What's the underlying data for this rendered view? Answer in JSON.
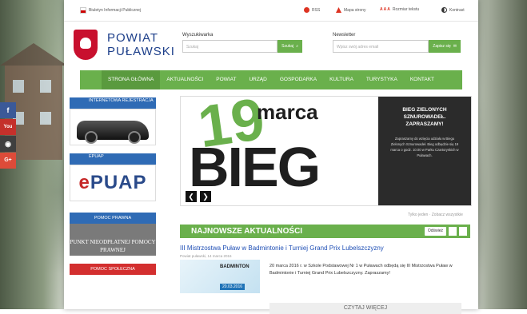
{
  "topbar": {
    "bip": "Biuletyn Informacji Publicznej",
    "rss": "RSS",
    "mapa": "Mapa strony",
    "aaa": "A A A",
    "rozmiar": "Rozmiar tekstu",
    "kontrast": "Kontrast"
  },
  "logo": {
    "line1": "POWIAT",
    "line2": "PUŁAWSKI"
  },
  "search": {
    "label": "Wyszukiwarka",
    "placeholder": "Szukaj",
    "button": "Szukaj"
  },
  "newsletter": {
    "label": "Newsletter",
    "placeholder": "Wpisz swój adres email",
    "button": "Zapisz się"
  },
  "nav": [
    "STRONA GŁÓWNA",
    "AKTUALNOŚCI",
    "POWIAT",
    "URZĄD",
    "GOSPODARKA",
    "KULTURA",
    "TURYSTYKA",
    "KONTAKT"
  ],
  "left_cards": {
    "reg_title": "INTERNETOWA REJESTRACJA",
    "epuap_title": "EPUAP",
    "epuap_logo_e": "e",
    "epuap_logo_rest": "PUAP",
    "pomoc_title": "POMOC PRAWNA",
    "pomoc_body": "PUNKT NIEODPŁATNEJ POMOCY PRAWNEJ",
    "spoleczna_title": "POMOC SPOŁECZNA"
  },
  "slider": {
    "big19": "19",
    "marca": "marca",
    "bieg": "BIEG",
    "heading": "BIEG ZIELONYCH SZNUROWADEŁ. ZAPRASZAMY!",
    "text": "Zapraszamy do wzięcia udziału w Biegu Zielonych Sznurowadeł. Bieg odbędzie się 19 marca o godz. 10.00 w Parku Czartoryskich w Puławach.",
    "prev": "❮",
    "next": "❯",
    "links": "Tylko jeden · Zobacz wszystkie"
  },
  "news": {
    "header": "NAJNOWSZE AKTUALNOŚCI",
    "odswiez": "Odśwież",
    "title": "III Mistrzostwa Puław w Badmintonie i Turniej Grand Prix Lubelszczyzny",
    "date": "Powiat puławski, 14 marca 2016",
    "thumb_title": "BADMINTON",
    "thumb_date": "20.03.2016",
    "text": "20 marca 2016 r. w Szkole Podstawowej Nr 1 w Puławach odbędą się III Mistrzostwa Puław w Badmintonie i Turniej Grand Prix Lubelszczyzny. Zapraszamy!",
    "more": "CZYTAJ WIĘCEJ"
  },
  "social": {
    "fb": "f",
    "yt": "You",
    "ig": "◉",
    "gp": "G+"
  },
  "colors": {
    "green": "#6ab04c",
    "blue": "#2f6bb5",
    "red": "#d32f2f"
  }
}
